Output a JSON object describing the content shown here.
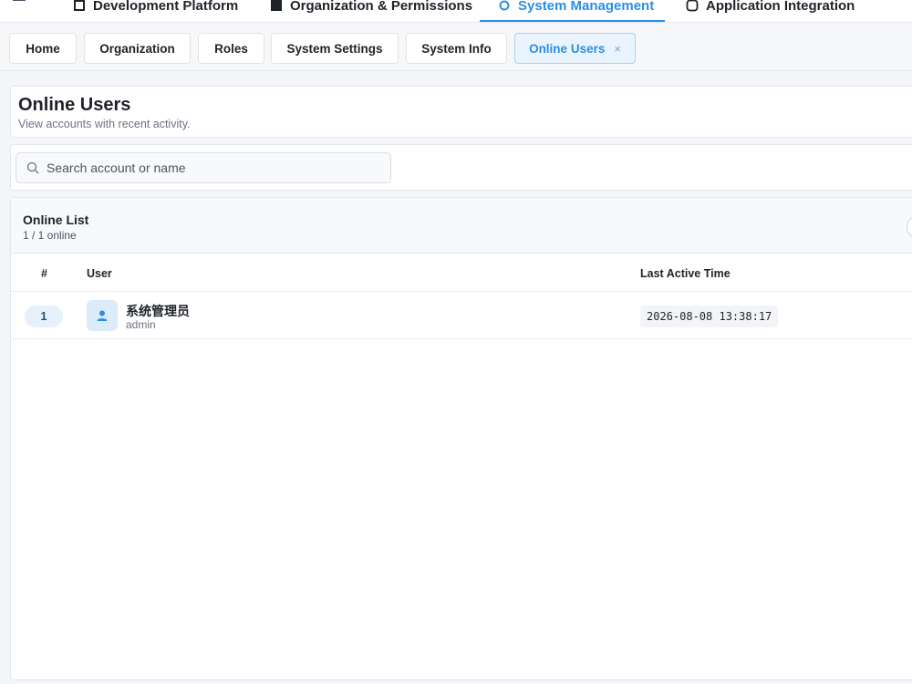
{
  "topnav": {
    "items": [
      {
        "label": "Development Platform",
        "icon": "box-icon",
        "active": false
      },
      {
        "label": "Organization & Permissions",
        "icon": "org-icon",
        "active": false
      },
      {
        "label": "System Management",
        "icon": "gear-icon",
        "active": true
      },
      {
        "label": "Application Integration",
        "icon": "plug-icon",
        "active": false
      }
    ]
  },
  "page_tabs": [
    {
      "label": "Home",
      "active": false
    },
    {
      "label": "Organization",
      "active": false
    },
    {
      "label": "Roles",
      "active": false
    },
    {
      "label": "System Settings",
      "active": false
    },
    {
      "label": "System Info",
      "active": false
    },
    {
      "label": "Online Users",
      "active": true,
      "close": "×"
    }
  ],
  "header": {
    "title": "Online Users",
    "subtitle": "View accounts with recent activity."
  },
  "search": {
    "placeholder": "Search account or name",
    "value": ""
  },
  "list": {
    "title": "Online List",
    "count": "1 / 1 online",
    "columns": {
      "index": "#",
      "user": "User",
      "last_active": "Last Active Time"
    },
    "rows": [
      {
        "index": "1",
        "name": "系统管理员",
        "account": "admin",
        "last_active": "2026-08-08 13:38:17"
      }
    ]
  },
  "colors": {
    "accent": "#2b8fe3",
    "active_tab_bg": "#eaf4fe",
    "avatar_bg": "#dcebfa",
    "index_badge_bg": "#e6f1fb"
  }
}
